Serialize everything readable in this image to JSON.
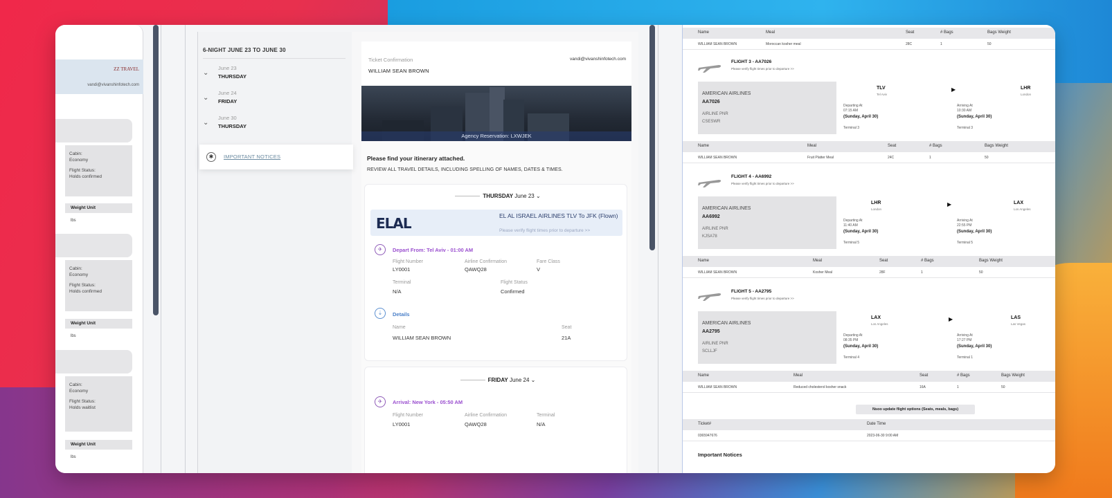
{
  "left_panel": {
    "logo": "ZZ TRAVEL",
    "email": "vandi@vivanshinfotech.com",
    "cabins": [
      {
        "cabin_label": "Cabin:",
        "cabin_value": "Economy",
        "status_label": "Flight Status:",
        "status_value": "Holds confirmed",
        "weight_unit": "Weight Unit",
        "unit": "lbs"
      },
      {
        "cabin_label": "Cabin:",
        "cabin_value": "Economy",
        "status_label": "Flight Status:",
        "status_value": "Holds confirmed",
        "weight_unit": "Weight Unit",
        "unit": "lbs"
      },
      {
        "cabin_label": "Cabin:",
        "cabin_value": "Economy",
        "status_label": "Flight Status:",
        "status_value": "Holds waitlist",
        "weight_unit": "Weight Unit",
        "unit": "lbs"
      }
    ]
  },
  "sidebar": {
    "trip_title": "6-NIGHT JUNE 23 TO JUNE 30",
    "days": [
      {
        "date": "June 23",
        "weekday": "THURSDAY"
      },
      {
        "date": "June 24",
        "weekday": "FRIDAY"
      },
      {
        "date": "June 30",
        "weekday": "THURSDAY"
      }
    ],
    "notices_label": "IMPORTANT NOTICES"
  },
  "itinerary": {
    "ticket_confirmation": "Ticket Confirmation",
    "passenger_name": "WILLIAM SEAN BROWN",
    "email": "vandi@vivanshinfotech.com",
    "agency_reservation": "Agency Reservation: LXWJEK",
    "find_text": "Please find your itinerary attached.",
    "review_text": "REVIEW ALL TRAVEL DETAILS, INCLUDING SPELLING OF NAMES, DATES & TIMES.",
    "day1": {
      "weekday": "THURSDAY",
      "date": "June 23",
      "airline_logo": "ELAL",
      "airline_title": "EL AL ISRAEL AIRLINES TLV To JFK (Flown)",
      "airline_note": "Please verify flight times prior to departure >>",
      "depart_title": "Depart From: Tel Aviv - 01:00 AM",
      "labels": {
        "flight_number": "Flight Number",
        "airline_conf": "Airline Confirmation",
        "fare_class": "Fare Class",
        "terminal": "Terminal",
        "flight_status": "Flight Status"
      },
      "values": {
        "flight_number": "LY0001",
        "airline_conf": "QAWQ28",
        "fare_class": "V",
        "terminal": "N/A",
        "flight_status": "Confirmed"
      },
      "details_title": "Details",
      "details_labels": {
        "name": "Name",
        "seat": "Seat"
      },
      "details_values": {
        "name": "WILLIAM SEAN BROWN",
        "seat": "21A"
      }
    },
    "day2": {
      "weekday": "FRIDAY",
      "date": "June 24",
      "arrival_title": "Arrival: New York - 05:50 AM",
      "labels": {
        "flight_number": "Flight Number",
        "airline_conf": "Airline Confirmation",
        "terminal": "Terminal"
      },
      "values": {
        "flight_number": "LY0001",
        "airline_conf": "QAWQ28",
        "terminal": "N/A"
      }
    }
  },
  "email_panel": {
    "table_headers": [
      "Name",
      "Meal",
      "Seat",
      "# Bags",
      "Bags Weight"
    ],
    "top_row": [
      "WILLIAM SEAN BROWN",
      "Moroccan kosher meal",
      "28C",
      "1",
      "50"
    ],
    "flights": [
      {
        "title": "FLIGHT 3 - AA7026",
        "sub": "Please verify flight times prior to departure >>",
        "airline": "AMERICAN AIRLINES",
        "code": "AA7026",
        "pnr_label": "AIRLINE PNR",
        "pnr": "CSESWR",
        "from": "TLV",
        "from_city": "Tel Aviv",
        "to": "LHR",
        "to_city": "London",
        "dep_label": "Departing At",
        "dep_time": "07:15 AM",
        "dep_date": "(Sunday, April 30)",
        "arr_label": "Arriving At",
        "arr_time": "10:30 AM",
        "arr_date": "(Sunday, April 30)",
        "terminal_dep": "Terminal 3",
        "terminal_arr": "Terminal 3",
        "row": [
          "WILLIAM SEAN BROWN",
          "Fruit Platter Meal",
          "24C",
          "1",
          "50"
        ]
      },
      {
        "title": "FLIGHT 4 - AA6992",
        "sub": "Please verify flight times prior to departure >>",
        "airline": "AMERICAN AIRLINES",
        "code": "AA6992",
        "pnr_label": "AIRLINE PNR",
        "pnr": "KJSA78",
        "from": "LHR",
        "from_city": "London",
        "to": "LAX",
        "to_city": "Los Angeles",
        "dep_label": "Departing At",
        "dep_time": "11:40 AM",
        "dep_date": "(Sunday, April 30)",
        "arr_label": "Arriving At",
        "arr_time": "22:55 PM",
        "arr_date": "(Sunday, April 30)",
        "terminal_dep": "Terminal 5",
        "terminal_arr": "Terminal 5",
        "row": [
          "WILLIAM SEAN BROWN",
          "Kosher Meal",
          "28F",
          "1",
          "50"
        ]
      },
      {
        "title": "FLIGHT 5 - AA2795",
        "sub": "Please verify flight times prior to departure >>",
        "airline": "AMERICAN AIRLINES",
        "code": "AA2795",
        "pnr_label": "AIRLINE PNR",
        "pnr": "SCLLJF",
        "from": "LAX",
        "from_city": "Los Angeles",
        "to": "LAS",
        "to_city": "Las Vegas",
        "dep_label": "Departing At",
        "dep_time": "08:35 PM",
        "dep_date": "(Sunday, April 30)",
        "arr_label": "Arriving At",
        "arr_time": "17:27 PM",
        "arr_date": "(Sunday, April 30)",
        "terminal_dep": "Terminal 4",
        "terminal_arr": "Terminal 1",
        "row": [
          "WILLIAM SEAN BROWN",
          "Reduced cholesterol kosher snack",
          "16A",
          "1",
          "50"
        ]
      }
    ],
    "update_button": "Nsoo update flight options (Seats, meals, bags)",
    "ticket_headers": [
      "Ticket#",
      "Date Time"
    ],
    "ticket_row": [
      "0365947676",
      "2023-06-30 9:00 AM"
    ],
    "important_notices": "Important Notices"
  }
}
